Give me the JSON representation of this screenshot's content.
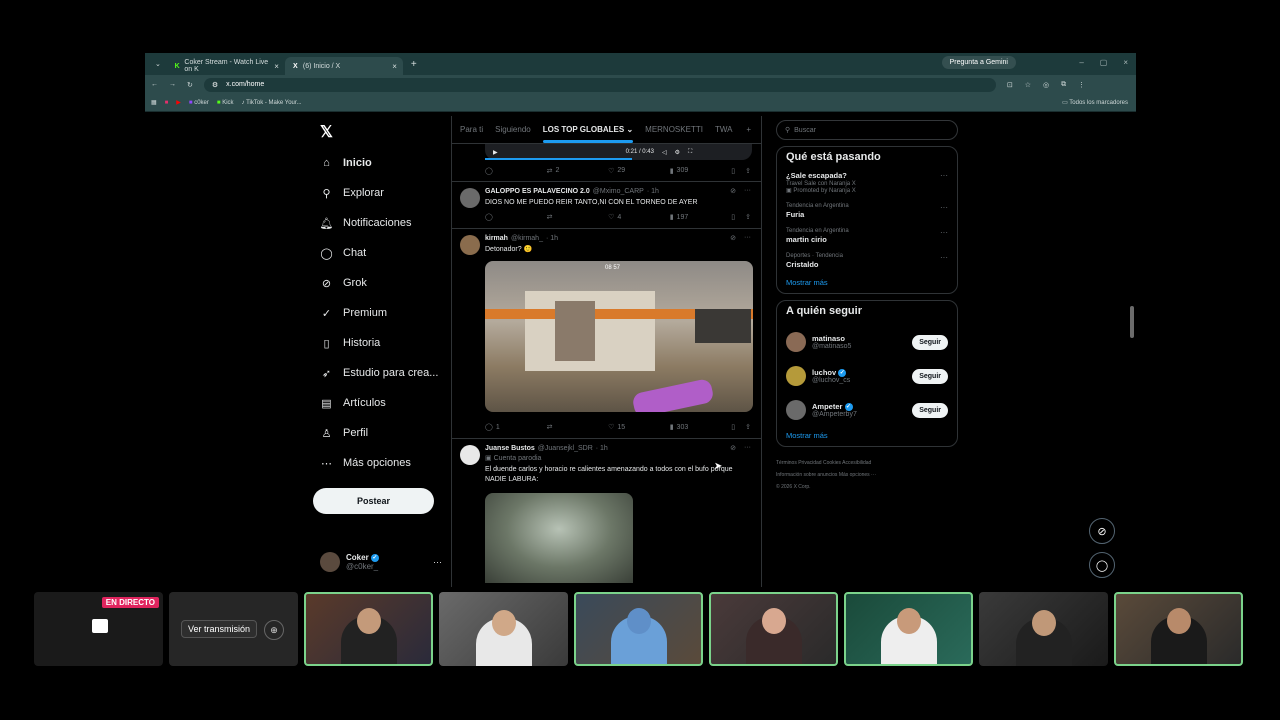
{
  "browser": {
    "tabs": [
      {
        "label": "Coker Stream - Watch Live on K"
      },
      {
        "label": "(6) Inicio / X"
      }
    ],
    "gemini_label": "Pregunta a Gemini",
    "url": "x.com/home",
    "bookmarks": [
      "c0ker",
      "Kick",
      "TikTok - Make Your..."
    ],
    "all_bookmarks": "Todos los marcadores"
  },
  "nav": {
    "items": [
      {
        "label": "Inicio"
      },
      {
        "label": "Explorar"
      },
      {
        "label": "Notificaciones"
      },
      {
        "label": "Chat"
      },
      {
        "label": "Grok"
      },
      {
        "label": "Premium"
      },
      {
        "label": "Historia"
      },
      {
        "label": "Estudio para crea..."
      },
      {
        "label": "Artículos"
      },
      {
        "label": "Perfil"
      },
      {
        "label": "Más opciones"
      }
    ],
    "post_label": "Postear",
    "account": {
      "name": "Coker",
      "handle": "@c0ker_"
    }
  },
  "feed": {
    "tabs": [
      "Para ti",
      "Siguiendo",
      "LOS TOP GLOBALES",
      "MERNOSKETTI",
      "TWA"
    ],
    "video_time": "0:21 / 0:43",
    "top_actions": {
      "reposts": "2",
      "likes": "29",
      "views": "309"
    },
    "tweets": [
      {
        "name": "GALOPPO ES PALAVECINO 2.0",
        "handle": "@Mximo_CARP",
        "time": "· 1h",
        "text": "DIOS NO ME PUEDO REIR TANTO,NI CON EL TORNEO DE AYER",
        "likes": "4",
        "views": "197"
      },
      {
        "name": "kirmah",
        "handle": "@kirmah_",
        "time": "· 1h",
        "text": "Detonador? 🙂",
        "hud": "08  57",
        "replies": "1",
        "likes": "15",
        "views": "303"
      },
      {
        "name": "Juanse Bustos",
        "handle": "@Juansejkl_SDR",
        "time": "· 1h",
        "tag": "Cuenta parodia",
        "text": "El duende carlos y horacio re calientes  amenazando a todos con el bufo porque NADIE LABURA:"
      }
    ]
  },
  "sidebar": {
    "search_placeholder": "Buscar",
    "trends_title": "Qué está pasando",
    "trends": [
      {
        "meta": "",
        "title": "¿Sale escapada?",
        "sub": "Travel Sale con Naranja X",
        "promo": "Promoted by Naranja X"
      },
      {
        "meta": "Tendencia en Argentina",
        "title": "Furia"
      },
      {
        "meta": "Tendencia en Argentina",
        "title": "martin cirio"
      },
      {
        "meta": "Deportes · Tendencia",
        "title": "Cristaldo"
      }
    ],
    "show_more": "Mostrar más",
    "follow_title": "A quién seguir",
    "follow": [
      {
        "name": "matinaso",
        "handle": "@matinaso5",
        "btn": "Seguir"
      },
      {
        "name": "luchov",
        "handle": "@luchov_cs",
        "btn": "Seguir"
      },
      {
        "name": "Ampeter",
        "handle": "@Ampeterby7",
        "btn": "Seguir"
      }
    ],
    "show_more2": "Mostrar más",
    "footer1": "Términos    Privacidad    Cookies    Accesibilidad",
    "footer2": "Información sobre anuncios    Más opciones ···",
    "footer3": "© 2026 X Corp."
  },
  "stream": {
    "live_badge": "EN DIRECTO",
    "watch_label": "Ver transmisión"
  },
  "colors": {
    "accent": "#1d9bf0",
    "chrome": "#2d4b4c",
    "live": "#e0245e",
    "speaker_border": "#7bd38b"
  },
  "icons": [
    "home-icon",
    "search-icon",
    "bell-icon",
    "chat-icon",
    "grok-icon",
    "premium-icon",
    "bookmark-icon",
    "rocket-icon",
    "article-icon",
    "person-icon",
    "more-icon"
  ]
}
